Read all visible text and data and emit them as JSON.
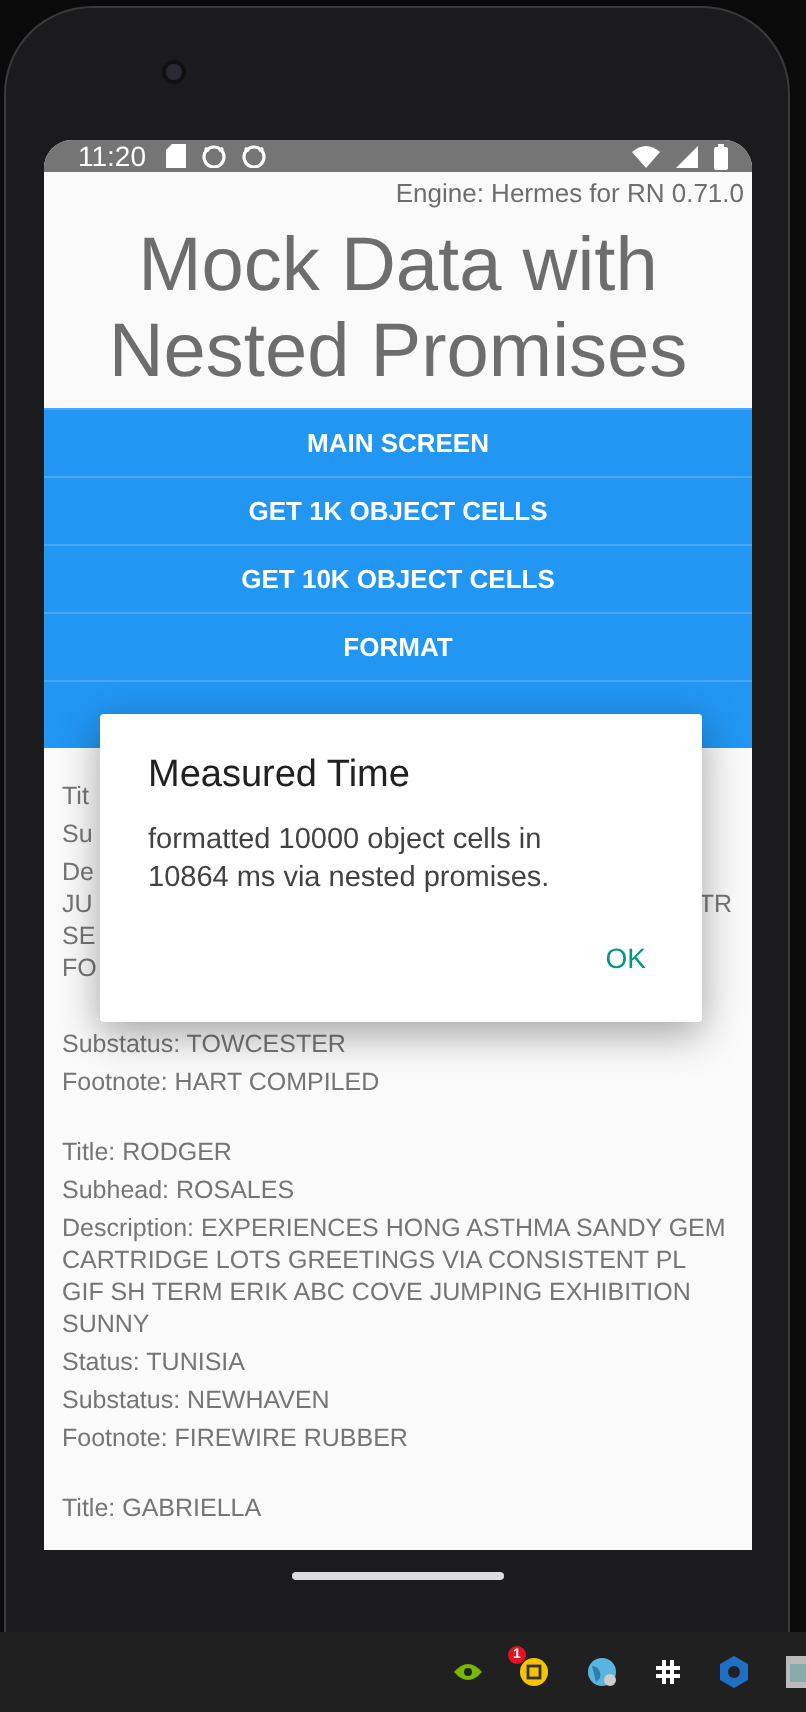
{
  "status_bar": {
    "time": "11:20"
  },
  "engine_label": "Engine: Hermes for RN 0.71.0",
  "title": "Mock Data with Nested Promises",
  "buttons": [
    {
      "kind": "labelled",
      "label": "MAIN SCREEN"
    },
    {
      "kind": "labelled",
      "label": "GET 1K OBJECT CELLS"
    },
    {
      "kind": "labelled",
      "label": "GET 10K OBJECT CELLS"
    },
    {
      "kind": "labelled",
      "label": "FORMAT"
    },
    {
      "kind": "covered"
    }
  ],
  "items": [
    {
      "lines": [
        {
          "kind": "line",
          "text": "Tit"
        },
        {
          "kind": "line",
          "text": "Su"
        },
        {
          "kind": "line",
          "text": "De"
        },
        {
          "kind": "cont",
          "text": "JU",
          "right": "TR"
        },
        {
          "kind": "cont",
          "text": "SE"
        },
        {
          "kind": "cont",
          "text": "FO"
        },
        {
          "kind": "covered"
        },
        {
          "kind": "line",
          "text": "Substatus: TOWCESTER"
        },
        {
          "kind": "line",
          "text": "Footnote: HART COMPILED"
        }
      ]
    },
    {
      "lines": [
        {
          "kind": "line",
          "text": "Title: RODGER"
        },
        {
          "kind": "line",
          "text": "Subhead: ROSALES"
        },
        {
          "kind": "line",
          "text": "Description: EXPERIENCES HONG ASTHMA SANDY GEM CARTRIDGE LOTS GREETINGS VIA CONSISTENT PL GIF SH TERM ERIK ABC COVE JUMPING EXHIBITION SUNNY"
        },
        {
          "kind": "line",
          "text": "Status: TUNISIA"
        },
        {
          "kind": "line",
          "text": "Substatus: NEWHAVEN"
        },
        {
          "kind": "line",
          "text": "Footnote: FIREWIRE RUBBER"
        }
      ]
    },
    {
      "lines": [
        {
          "kind": "line",
          "text": "Title: GABRIELLA"
        }
      ]
    }
  ],
  "dialog": {
    "title": "Measured Time",
    "message": "formatted 10000 object cells in 10864 ms via nested promises.",
    "button": "OK"
  },
  "taskbar": {
    "badge": "1"
  }
}
